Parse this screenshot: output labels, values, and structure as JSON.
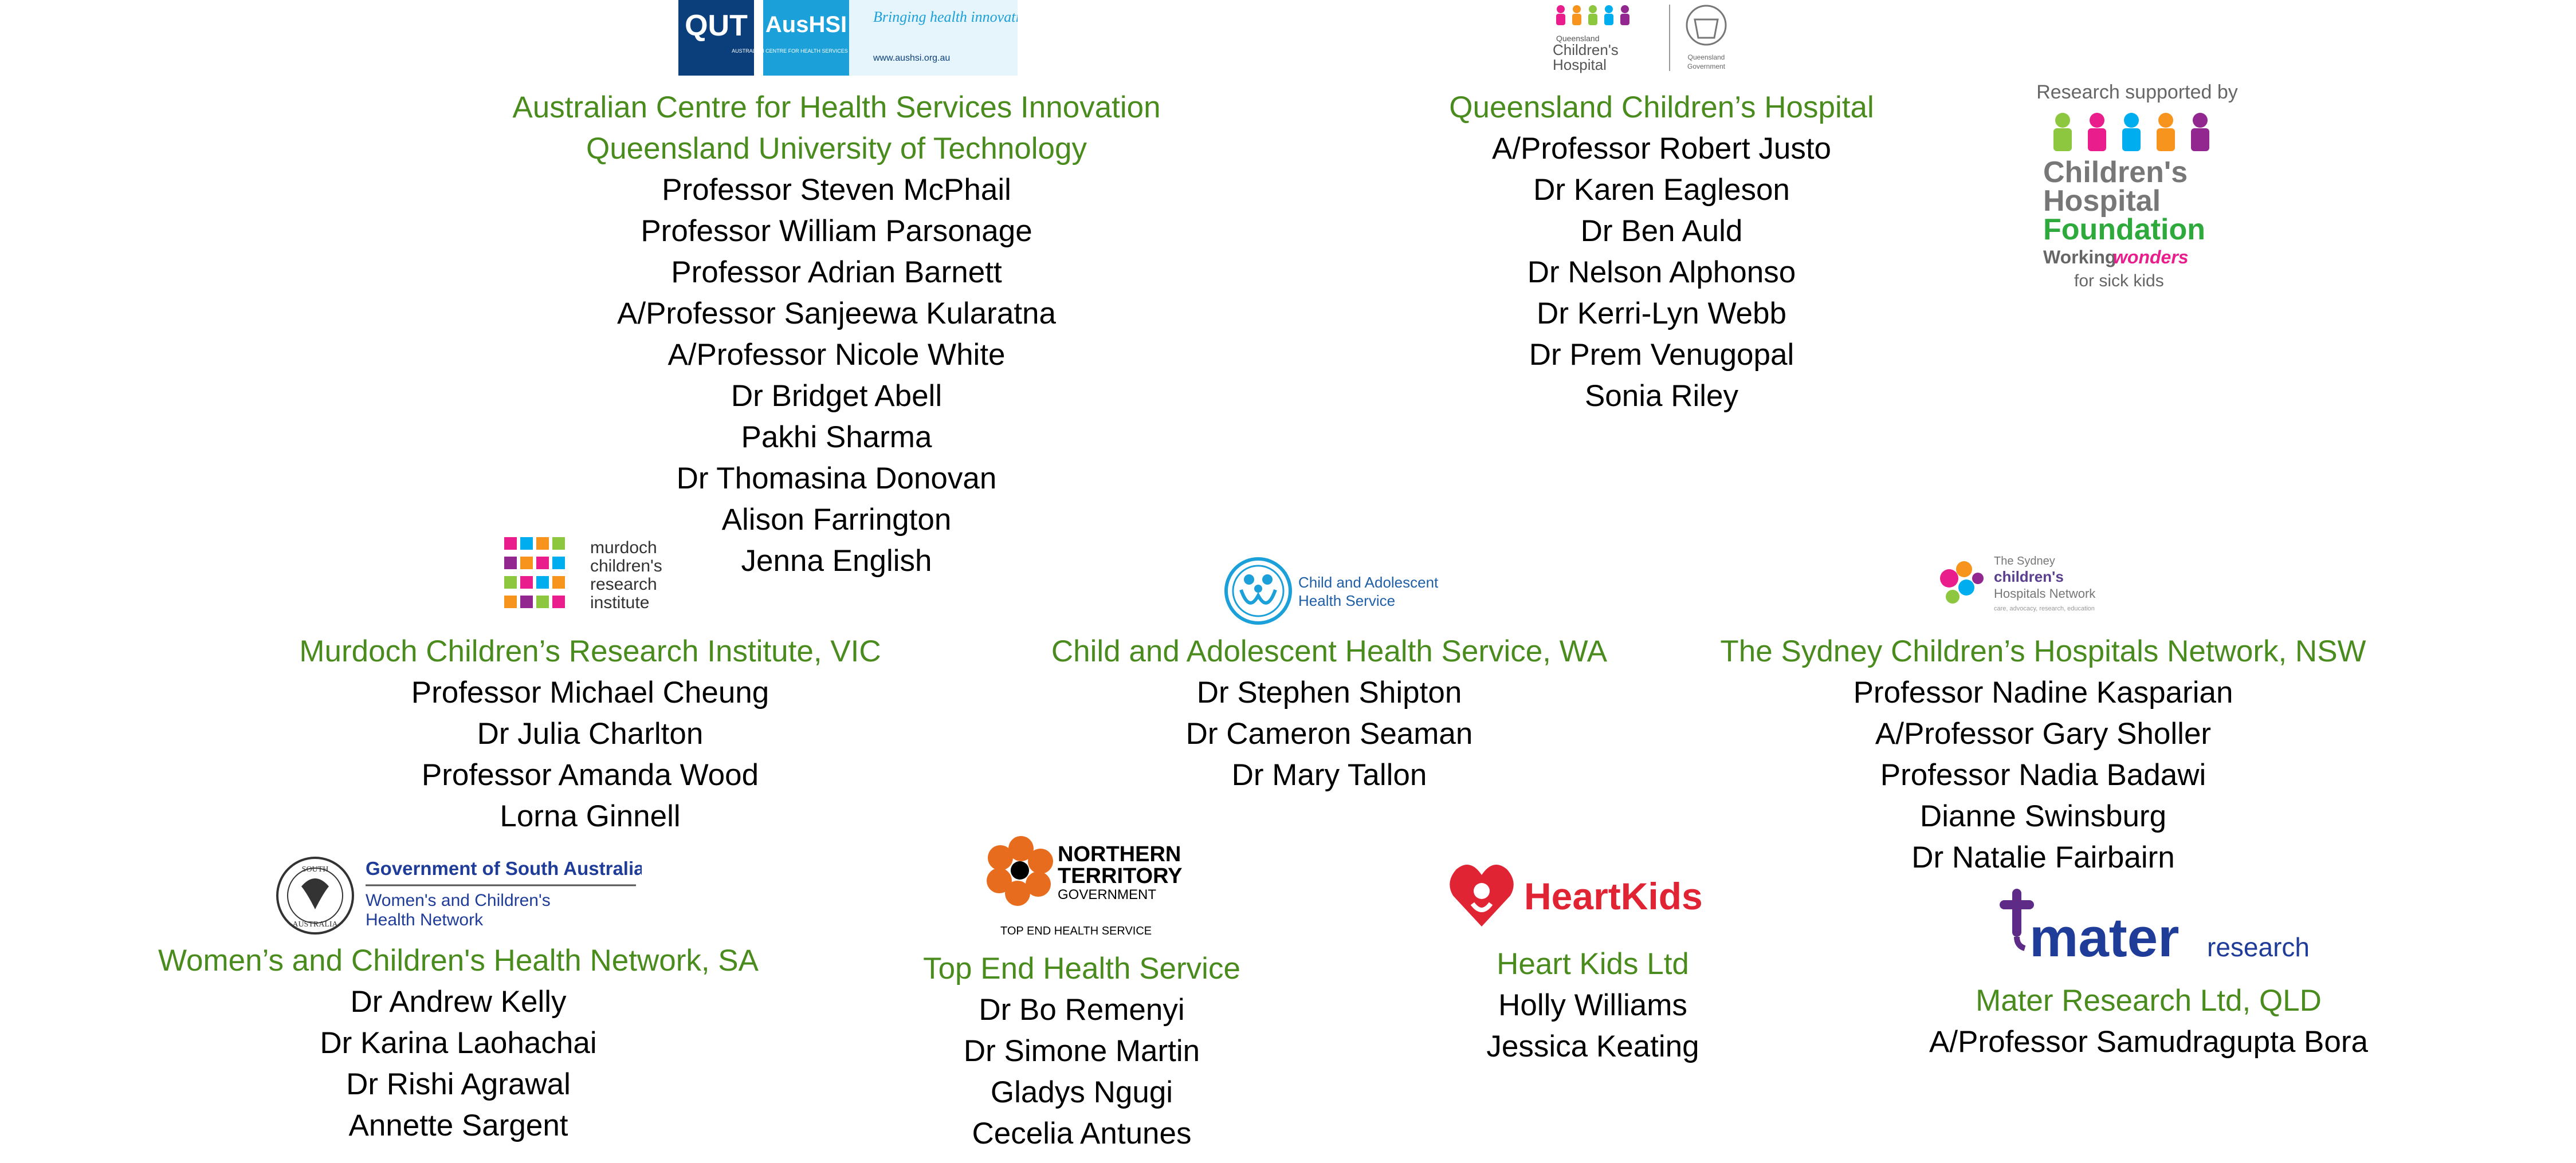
{
  "colors": {
    "org": "#4a8b1e",
    "person": "#000000",
    "qut_blue": "#0b3f7c",
    "aushsi_blue": "#1ba0d9",
    "heart_red": "#e02434",
    "mater_purple": "#5e2c87",
    "mater_blue": "#1f3c99",
    "nt_orange": "#e86c1e"
  },
  "logos": {
    "qut": {
      "icon": "qut-logo",
      "text": "QUT"
    },
    "aushsi": {
      "icon": "aushsi-logo",
      "name": "AusHSI",
      "tagline": "Bringing health innovation to life",
      "sub": "AUSTRALIAN CENTRE FOR HEALTH SERVICES INNOVATION",
      "url": "www.aushsi.org.au"
    },
    "qch": {
      "icon": "queensland-childrens-hospital-logo",
      "line1": "Queensland",
      "line2": "Children's",
      "line3": "Hospital",
      "gov1": "Queensland",
      "gov2": "Government"
    },
    "chf": {
      "icon": "childrens-hospital-foundation-logo",
      "supported": "Research supported by",
      "line1": "Children's",
      "line2": "Hospital",
      "line3": "Foundation",
      "tag1": "Working",
      "tag2": "wonders",
      "tag3": "for sick kids"
    },
    "mcri": {
      "icon": "murdoch-childrens-research-institute-logo",
      "line1": "murdoch",
      "line2": "children's",
      "line3": "research",
      "line4": "institute"
    },
    "cahs": {
      "icon": "child-adolescent-health-service-logo",
      "line1": "Child and Adolescent",
      "line2": "Health Service"
    },
    "schn": {
      "icon": "sydney-childrens-hospitals-network-logo",
      "line1": "The Sydney",
      "line2": "children's",
      "line3": "Hospitals Network",
      "tag": "care, advocacy, research, education"
    },
    "sa": {
      "icon": "government-south-australia-logo",
      "title": "Government of South Australia",
      "line1": "Women's and Children's",
      "line2": "Health Network",
      "seal1": "SOUTH",
      "seal2": "AUSTRALIA"
    },
    "nt": {
      "icon": "northern-territory-government-logo",
      "line1": "NORTHERN",
      "line2": "TERRITORY",
      "line3": "GOVERNMENT",
      "sub": "TOP END HEALTH SERVICE"
    },
    "heartkids": {
      "icon": "heartkids-logo",
      "text": "HeartKids"
    },
    "mater": {
      "icon": "mater-research-logo",
      "name": "mater",
      "sub": "research"
    }
  },
  "blocks": {
    "aushsi": {
      "orgs": [
        "Australian Centre for Health Services Innovation",
        "Queensland University of Technology"
      ],
      "people": [
        "Professor Steven McPhail",
        "Professor William Parsonage",
        "Professor Adrian Barnett",
        "A/Professor Sanjeewa Kularatna",
        "A/Professor Nicole White",
        "Dr Bridget Abell",
        "Pakhi Sharma",
        "Dr Thomasina Donovan",
        "Alison Farrington",
        "Jenna English"
      ]
    },
    "qch": {
      "orgs": [
        "Queensland Children’s Hospital"
      ],
      "people": [
        "A/Professor Robert Justo",
        "Dr Karen Eagleson",
        "Dr Ben Auld",
        "Dr Nelson Alphonso",
        "Dr Kerri-Lyn Webb",
        "Dr Prem Venugopal",
        "Sonia Riley"
      ]
    },
    "mcri": {
      "orgs": [
        "Murdoch Children’s Research Institute, VIC"
      ],
      "people": [
        "Professor Michael Cheung",
        "Dr Julia Charlton",
        "Professor Amanda Wood",
        "Lorna Ginnell"
      ]
    },
    "cahs": {
      "orgs": [
        "Child and Adolescent Health Service, WA"
      ],
      "people": [
        "Dr Stephen Shipton",
        "Dr Cameron Seaman",
        "Dr Mary Tallon"
      ]
    },
    "schn": {
      "orgs": [
        "The Sydney Children’s Hospitals Network, NSW"
      ],
      "people": [
        "Professor Nadine Kasparian",
        "A/Professor Gary Sholler",
        "Professor Nadia Badawi",
        "Dianne Swinsburg",
        "Dr Natalie Fairbairn"
      ]
    },
    "sa": {
      "orgs": [
        "Women’s and Children's Health Network, SA"
      ],
      "people": [
        "Dr Andrew Kelly",
        "Dr Karina Laohachai",
        "Dr Rishi Agrawal",
        "Annette Sargent"
      ]
    },
    "nt": {
      "orgs": [
        "Top End Health Service"
      ],
      "people": [
        "Dr Bo Remenyi",
        "Dr Simone Martin",
        "Gladys Ngugi",
        "Cecelia Antunes"
      ]
    },
    "heartkids": {
      "orgs": [
        "Heart Kids Ltd"
      ],
      "people": [
        "Holly Williams",
        "Jessica Keating"
      ]
    },
    "mater": {
      "orgs": [
        "Mater Research Ltd, QLD"
      ],
      "people": [
        "A/Professor Samudragupta Bora"
      ]
    }
  }
}
